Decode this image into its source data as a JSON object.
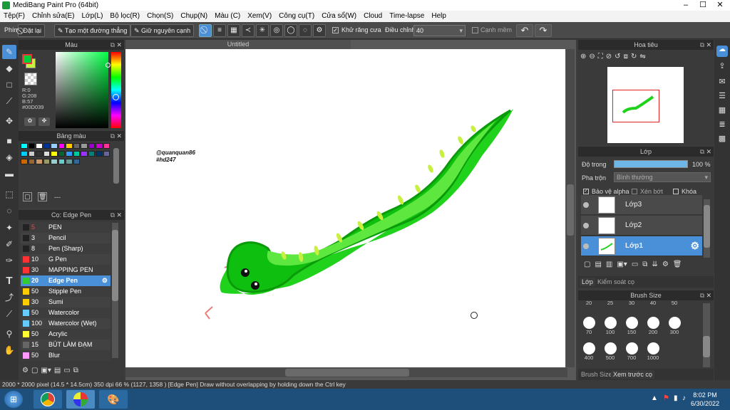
{
  "titlebar": {
    "title": "MediBang Paint Pro (64bit)",
    "minimize": "–",
    "maximize": "☐",
    "close": "✕"
  },
  "menu": [
    "Tệp(F)",
    "Chỉnh sửa(E)",
    "Lớp(L)",
    "Bộ lọc(R)",
    "Chọn(S)",
    "Chụp(N)",
    "Màu (C)",
    "Xem(V)",
    "Công cụ(T)",
    "Cửa sổ(W)",
    "Cloud",
    "Time-lapse",
    "Help"
  ],
  "toolbar": {
    "label_phim": "Phím",
    "undo_label": "Đặt lại",
    "straight_label": "Tạo một đường thẳng",
    "keep_edge_label": "Giữ nguyên cạnh",
    "antialias_label": "Khử răng cưa",
    "adjust_label": "Điều chỉnh",
    "adjust_value": "40",
    "smooth_label": "Cạnh mềm"
  },
  "color_panel": {
    "title": "Màu",
    "r": "R:0",
    "g": "G:208",
    "b": "B:57",
    "hex": "#00D039",
    "fg": "#00d039",
    "bg": "#c8f040"
  },
  "palette_panel": {
    "title": "Bảng màu",
    "colors": [
      "#00ffff",
      "#000000",
      "#ffffff",
      "#003399",
      "#99ccff",
      "#ff00ff",
      "#ffcc00",
      "#666666",
      "#999999",
      "#9900cc",
      "#cc00cc",
      "#ff3399",
      "#00ccff",
      "#cccccc",
      "#333333",
      "#dddddd",
      "#ffff00",
      "#006633",
      "#3399ff",
      "#00cc99",
      "#9933ff",
      "#008080",
      "#003366",
      "#666699",
      "#cc6600",
      "#996633",
      "#cc9966",
      "#999966",
      "#99cccc",
      "#66cccc",
      "#669999",
      "#336699"
    ],
    "dash": "---"
  },
  "brush_panel": {
    "title": "Cọ: Edge Pen",
    "items": [
      {
        "size": "5",
        "name": "PEN",
        "color": "#222222"
      },
      {
        "size": "3",
        "name": "Pencil",
        "color": "#222222"
      },
      {
        "size": "8",
        "name": "Pen (Sharp)",
        "color": "#222222"
      },
      {
        "size": "10",
        "name": "G Pen",
        "color": "#ff3333"
      },
      {
        "size": "30",
        "name": "MAPPING PEN",
        "color": "#ff3333"
      },
      {
        "size": "20",
        "name": "Edge Pen",
        "color": "#33cc33"
      },
      {
        "size": "50",
        "name": "Stipple Pen",
        "color": "#ffcc00"
      },
      {
        "size": "30",
        "name": "Sumi",
        "color": "#ffcc00"
      },
      {
        "size": "50",
        "name": "Watercolor",
        "color": "#66ccff"
      },
      {
        "size": "100",
        "name": "Watercolor (Wet)",
        "color": "#66ccff"
      },
      {
        "size": "50",
        "name": "Acrylic",
        "color": "#ffff33"
      },
      {
        "size": "15",
        "name": "BÚT LÀM ĐẠM NHẠT",
        "color": "#666666"
      },
      {
        "size": "50",
        "name": "Blur",
        "color": "#ff99ff"
      }
    ]
  },
  "canvas": {
    "tab": "Untitled",
    "watermark1": "@quanquan86",
    "watermark2": "#hd247"
  },
  "navigator": {
    "title": "Hoa tiêu"
  },
  "layers": {
    "title": "Lớp",
    "opacity_label": "Độ trong",
    "opacity_value": "100 %",
    "blend_label": "Pha trộn",
    "blend_value": "Bình thường",
    "protect_alpha": "Bảo vệ alpha",
    "clipping": "Xén bớt",
    "lock": "Khóa",
    "items": [
      "Lớp3",
      "Lớp2",
      "Lớp1"
    ],
    "tab_layer": "Lớp",
    "tab_brush_ctrl": "Kiểm soát cọ"
  },
  "brush_size": {
    "title": "Brush Size",
    "sizes": [
      "20",
      "25",
      "30",
      "40",
      "50",
      "70",
      "100",
      "150",
      "200",
      "300",
      "400",
      "500",
      "700",
      "1000"
    ],
    "tab1": "Brush Size",
    "tab2": "Xem trước cọ"
  },
  "status": {
    "text": "2000 * 2000 pixel  (14.5 * 14.5cm)  350 dpi  66 %  (1127, 1358 )  [Edge Pen] Draw without overlapping by holding down the Ctrl key"
  },
  "taskbar": {
    "time": "8:02 PM",
    "date": "6/30/2022"
  }
}
